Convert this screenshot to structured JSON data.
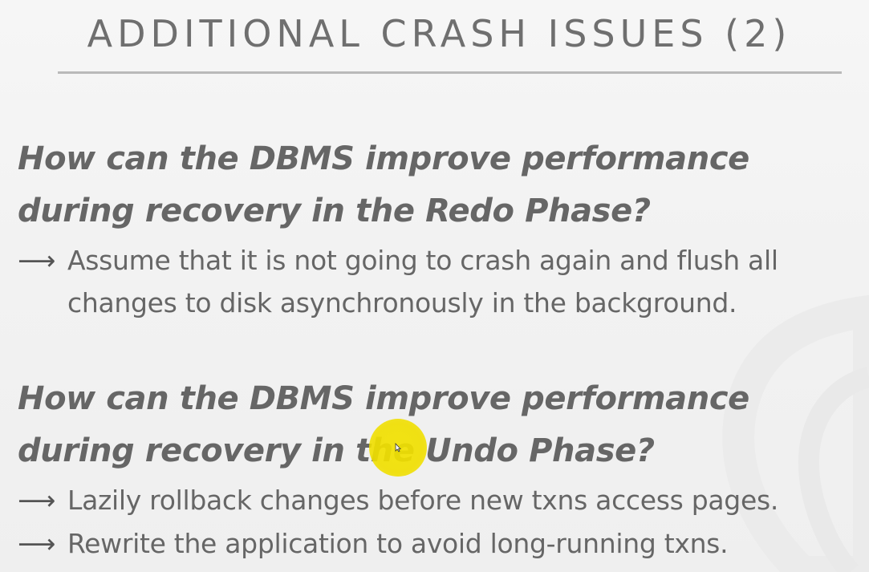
{
  "slide": {
    "title": "ADDITIONAL CRASH ISSUES (2)",
    "sections": [
      {
        "question": "How can the DBMS improve performance during recovery in the Redo Phase?",
        "bullets": [
          "Assume that it is not going to crash again and flush all\nchanges to disk asynchronously in the background."
        ]
      },
      {
        "question": "How can the DBMS improve performance during recovery in the Undo Phase?",
        "bullets": [
          "Lazily rollback changes before new txns access pages.",
          "Rewrite the application to avoid long-running txns."
        ]
      }
    ],
    "bullet_arrow": "⟶",
    "colors": {
      "text": "#666666",
      "title": "#6f6f6f",
      "rule": "#b9b9b9",
      "highlight": "#f2e200",
      "background": "#f2f2f2"
    }
  }
}
